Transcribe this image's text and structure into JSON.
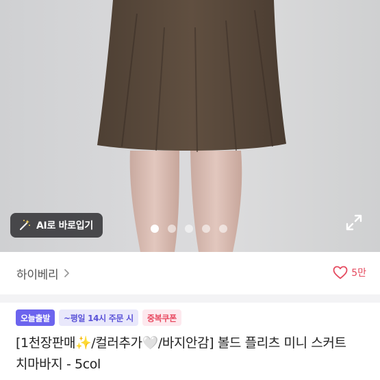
{
  "gallery": {
    "ai_button_label": "AI로 바로입기",
    "slide_count": 5,
    "active_slide_index": 0
  },
  "store": {
    "name": "하이베리",
    "like_count": "5만",
    "like_color": "#e5495e"
  },
  "badges": {
    "today_shipping": "오늘출발",
    "cutoff": "~평일 14시 주문 시",
    "coupon": "중복쿠폰"
  },
  "product": {
    "title": "[1천장판매✨/컬러추가🤍/바지안감] 볼드 플리츠 미니 스커트 치마바지 - 5col"
  },
  "colors": {
    "accent": "#6c64ee",
    "skirt": "#5a4a3c"
  },
  "icons": [
    "magic-wand-icon",
    "expand-icon",
    "chevron-right-icon",
    "heart-outline-icon"
  ]
}
